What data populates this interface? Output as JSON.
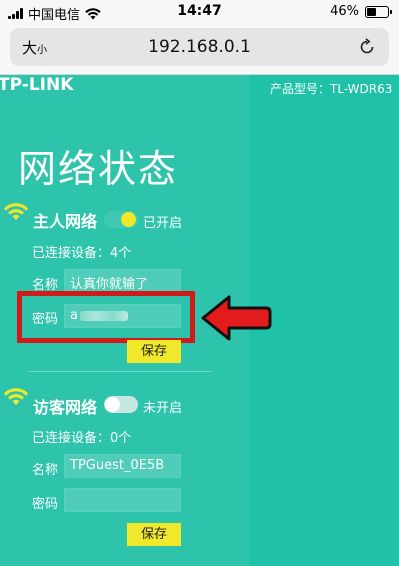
{
  "status_bar": {
    "carrier": "中国电信",
    "time": "14:47",
    "battery": "46%",
    "battery_level": 0.46
  },
  "browser": {
    "text_size_label": "大",
    "text_size_small": "小",
    "url": "192.168.0.1",
    "reload_icon": "reload-icon"
  },
  "page": {
    "logo": "TP-LINK",
    "model": "产品型号：TL-WDR63",
    "title": "网络状态",
    "host_network": {
      "title": "主人网络",
      "toggle_state": "已开启",
      "enabled": true,
      "connected": "已连接设备：4个",
      "name_label": "名称",
      "name_value": "认真你就输了",
      "password_label": "密码",
      "password_value": "a",
      "save_label": "保存"
    },
    "guest_network": {
      "title": "访客网络",
      "toggle_state": "未开启",
      "enabled": false,
      "connected": "已连接设备：0个",
      "name_label": "名称",
      "name_value": "TPGuest_0E5B",
      "password_label": "密码",
      "password_value": "",
      "save_label": "保存"
    }
  },
  "colors": {
    "teal": "#2ec4ac",
    "highlight": "#d11a1a",
    "save_button": "#f0e82a",
    "toggle_on": "#f0e82a"
  }
}
